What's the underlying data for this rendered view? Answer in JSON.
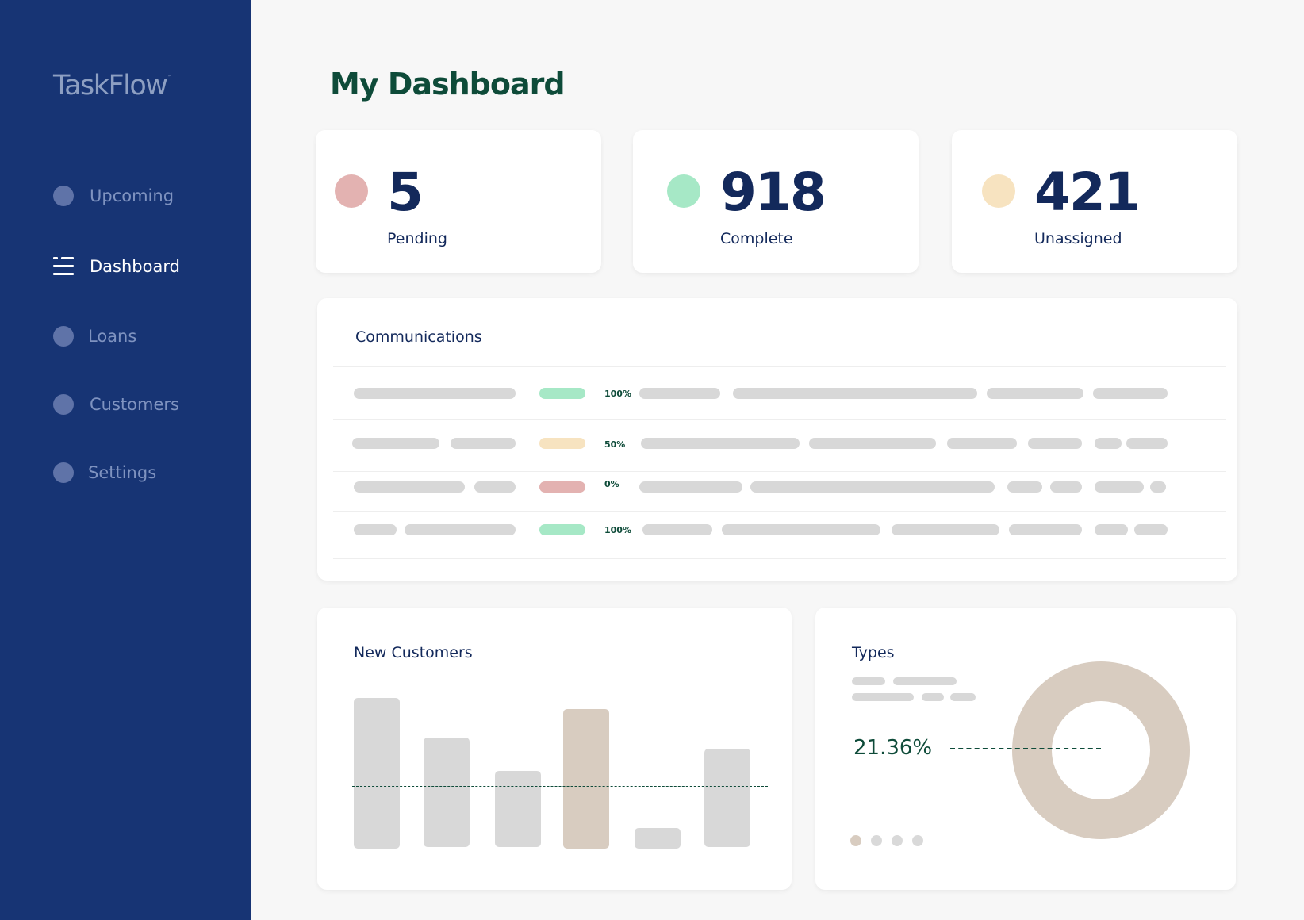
{
  "app": {
    "name": "TaskFlow"
  },
  "sidebar": {
    "items": [
      {
        "label": "Upcoming",
        "active": false
      },
      {
        "label": "Dashboard",
        "active": true
      },
      {
        "label": "Loans",
        "active": false
      },
      {
        "label": "Customers",
        "active": false
      },
      {
        "label": "Settings",
        "active": false
      }
    ]
  },
  "page": {
    "title": "My Dashboard"
  },
  "stats": [
    {
      "value": "5",
      "label": "Pending",
      "color": "#e3b2b1"
    },
    {
      "value": "918",
      "label": "Complete",
      "color": "#a6e8c6"
    },
    {
      "value": "421",
      "label": "Unassigned",
      "color": "#f7e3c0"
    }
  ],
  "communications": {
    "title": "Communications",
    "rows": [
      {
        "percent": "100%",
        "status_color": "#a6e8c6"
      },
      {
        "percent": "50%",
        "status_color": "#f7e3c0"
      },
      {
        "percent": "0%",
        "status_color": "#e3b2b1"
      },
      {
        "percent": "100%",
        "status_color": "#a6e8c6"
      }
    ]
  },
  "new_customers": {
    "title": "New Customers",
    "highlight_color": "#d8ccc0"
  },
  "types": {
    "title": "Types",
    "percent": "21.36%",
    "donut_color": "#d8ccc0"
  }
}
